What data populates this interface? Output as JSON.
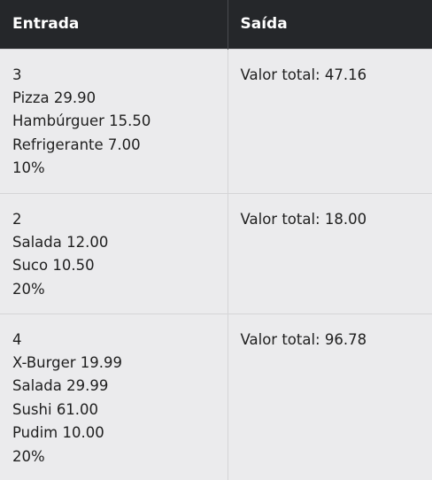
{
  "table": {
    "headers": {
      "input": "Entrada",
      "output": "Saída"
    },
    "rows": [
      {
        "input_lines": [
          "3",
          "Pizza 29.90",
          "Hambúrguer 15.50",
          "Refrigerante 7.00",
          "10%"
        ],
        "output": "Valor total: 47.16"
      },
      {
        "input_lines": [
          "2",
          "Salada 12.00",
          "Suco 10.50",
          "20%"
        ],
        "output": "Valor total: 18.00"
      },
      {
        "input_lines": [
          "4",
          "X-Burger 19.99",
          "Salada 29.99",
          "Sushi 61.00",
          "Pudim 10.00",
          "20%"
        ],
        "output": "Valor total: 96.78"
      }
    ]
  }
}
